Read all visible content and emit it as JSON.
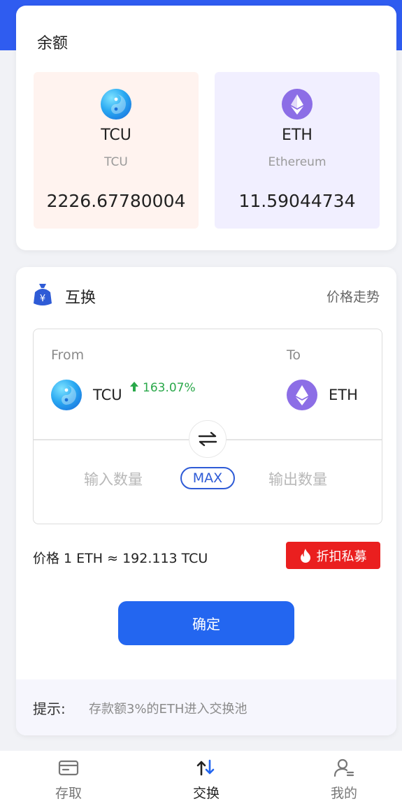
{
  "balance": {
    "title": "余额",
    "assets": [
      {
        "symbol": "TCU",
        "name": "TCU",
        "amount": "2226.67780004",
        "icon": "tcu-coin-icon"
      },
      {
        "symbol": "ETH",
        "name": "Ethereum",
        "amount": "11.59044734",
        "icon": "eth-coin-icon"
      }
    ]
  },
  "swap": {
    "title": "互换",
    "trend_link": "价格走势",
    "from_label": "From",
    "to_label": "To",
    "from_symbol": "TCU",
    "from_change": "163.07%",
    "to_symbol": "ETH",
    "input_placeholder": "输入数量",
    "max_label": "MAX",
    "output_placeholder": "输出数量",
    "price_text": "价格 1 ETH ≈ 192.113 TCU",
    "discount_label": "折扣私募",
    "confirm_label": "确定",
    "tip_label": "提示:",
    "tip_text": "存款额3%的ETH进入交换池"
  },
  "colors": {
    "accent": "#2366f0",
    "up": "#2aa84a",
    "danger": "#ea1f1f"
  },
  "nav": {
    "items": [
      {
        "label": "存取",
        "icon": "wallet-icon",
        "active": false
      },
      {
        "label": "交换",
        "icon": "exchange-icon",
        "active": true
      },
      {
        "label": "我的",
        "icon": "user-icon",
        "active": false
      }
    ]
  }
}
